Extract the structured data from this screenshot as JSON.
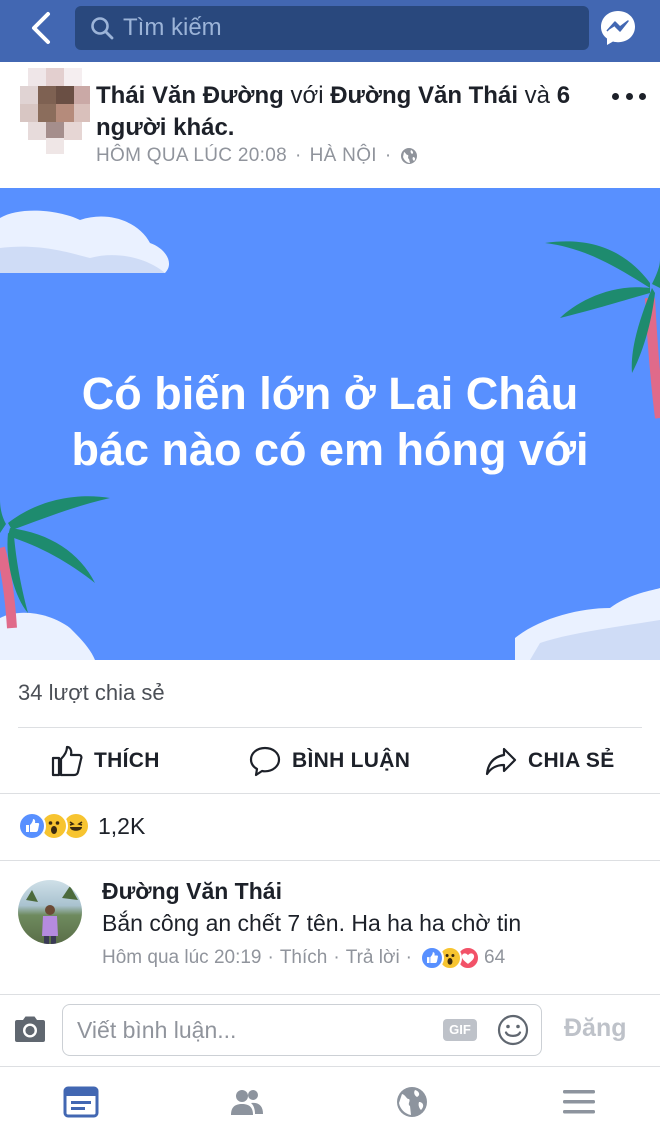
{
  "header": {
    "search_placeholder": "Tìm kiếm",
    "accent_color": "#4267b2"
  },
  "post": {
    "author": "Thái Văn Đường",
    "with_word": "với",
    "tagged": "Đường Văn Thái",
    "and_word": "và",
    "others": "6 người khác.",
    "time": "HÔM QUA LÚC 20:08",
    "location": "HÀ NỘI",
    "banner_line1": "Có biến lớn ở Lai Châu",
    "banner_line2": "bác nào có em hóng với",
    "banner_color": "#5890ff",
    "shares": "34 lượt chia sẻ"
  },
  "actions": {
    "like": "THÍCH",
    "comment": "BÌNH LUẬN",
    "share": "CHIA SẺ"
  },
  "reactions": {
    "icons": [
      "like-icon",
      "wow-icon",
      "haha-icon"
    ],
    "count": "1,2K"
  },
  "comment": {
    "author": "Đường Văn Thái",
    "text": "Bắn công an chết 7 tên. Ha ha ha chờ tin",
    "time": "Hôm qua lúc 20:19",
    "like": "Thích",
    "reply": "Trả lời",
    "reaction_icons": [
      "like-icon",
      "wow-icon",
      "love-icon"
    ],
    "reaction_count": "64"
  },
  "composer": {
    "placeholder": "Viết bình luận...",
    "gif": "GIF",
    "post": "Đăng"
  },
  "tabs": [
    "news-feed-icon",
    "friends-icon",
    "globe-icon",
    "menu-icon"
  ]
}
